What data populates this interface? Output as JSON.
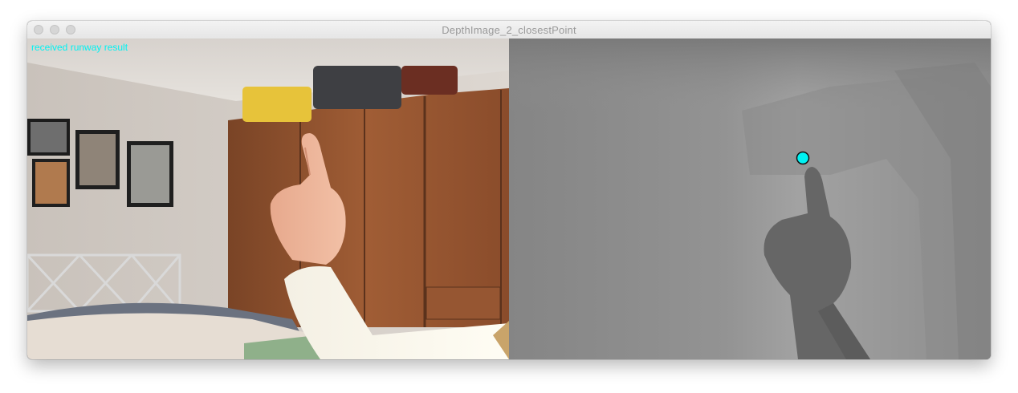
{
  "window": {
    "title": "DepthImage_2_closestPoint"
  },
  "camera_view": {
    "status_text": "received runway result"
  },
  "depth_view": {
    "marker_color": "#00f2f2",
    "marker_icon": "closest-point-icon"
  },
  "colors": {
    "status_text": "#00f2f2",
    "depth_background": "#8c8c8c"
  }
}
